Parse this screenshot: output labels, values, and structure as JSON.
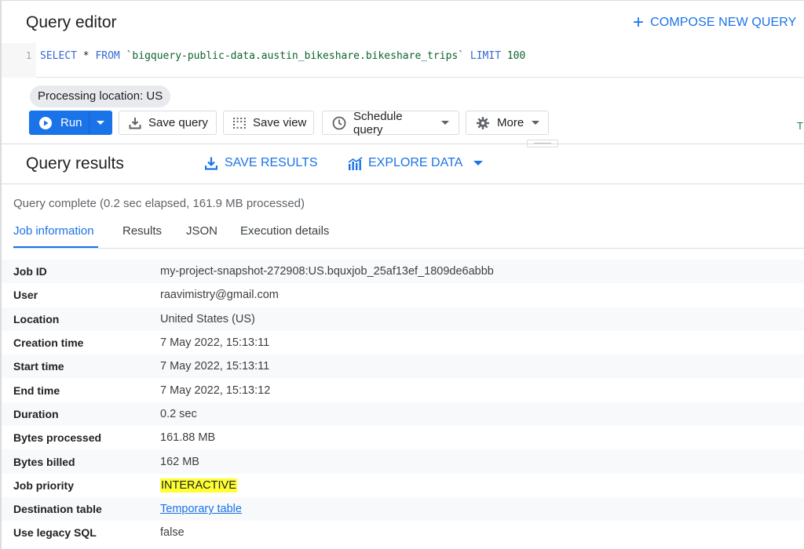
{
  "editor": {
    "title": "Query editor",
    "compose_label": "COMPOSE NEW QUERY",
    "line_number": "1",
    "query": {
      "select": "SELECT",
      "star": " * ",
      "from": "FROM",
      "table": " `bigquery-public-data.austin_bikeshare.bikeshare_trips` ",
      "limit": "LIMIT",
      "limit_value": " 100"
    },
    "processing_location": "Processing location: US",
    "partial_edge_text": "T"
  },
  "toolbar": {
    "run_label": "Run",
    "save_query_label": "Save query",
    "save_view_label": "Save view",
    "schedule_label": "Schedule query",
    "more_label": "More"
  },
  "results": {
    "title": "Query results",
    "save_results_label": "SAVE RESULTS",
    "explore_label": "EXPLORE DATA",
    "status": "Query complete (0.2 sec elapsed, 161.9 MB processed)",
    "tabs": [
      {
        "label": "Job information"
      },
      {
        "label": "Results"
      },
      {
        "label": "JSON"
      },
      {
        "label": "Execution details"
      }
    ],
    "job_info": [
      {
        "key": "Job ID",
        "value": "my-project-snapshot-272908:US.bquxjob_25af13ef_1809de6abbb"
      },
      {
        "key": "User",
        "value": "raavimistry@gmail.com"
      },
      {
        "key": "Location",
        "value": "United States (US)"
      },
      {
        "key": "Creation time",
        "value": "7 May 2022, 15:13:11"
      },
      {
        "key": "Start time",
        "value": "7 May 2022, 15:13:11"
      },
      {
        "key": "End time",
        "value": "7 May 2022, 15:13:12"
      },
      {
        "key": "Duration",
        "value": "0.2 sec"
      },
      {
        "key": "Bytes processed",
        "value": "161.88 MB"
      },
      {
        "key": "Bytes billed",
        "value": "162 MB"
      },
      {
        "key": "Job priority",
        "value": "INTERACTIVE"
      },
      {
        "key": "Destination table",
        "value": "Temporary table"
      },
      {
        "key": "Use legacy SQL",
        "value": "false"
      }
    ]
  },
  "colors": {
    "accent": "#1a73e8",
    "highlight": "#ffff33"
  }
}
